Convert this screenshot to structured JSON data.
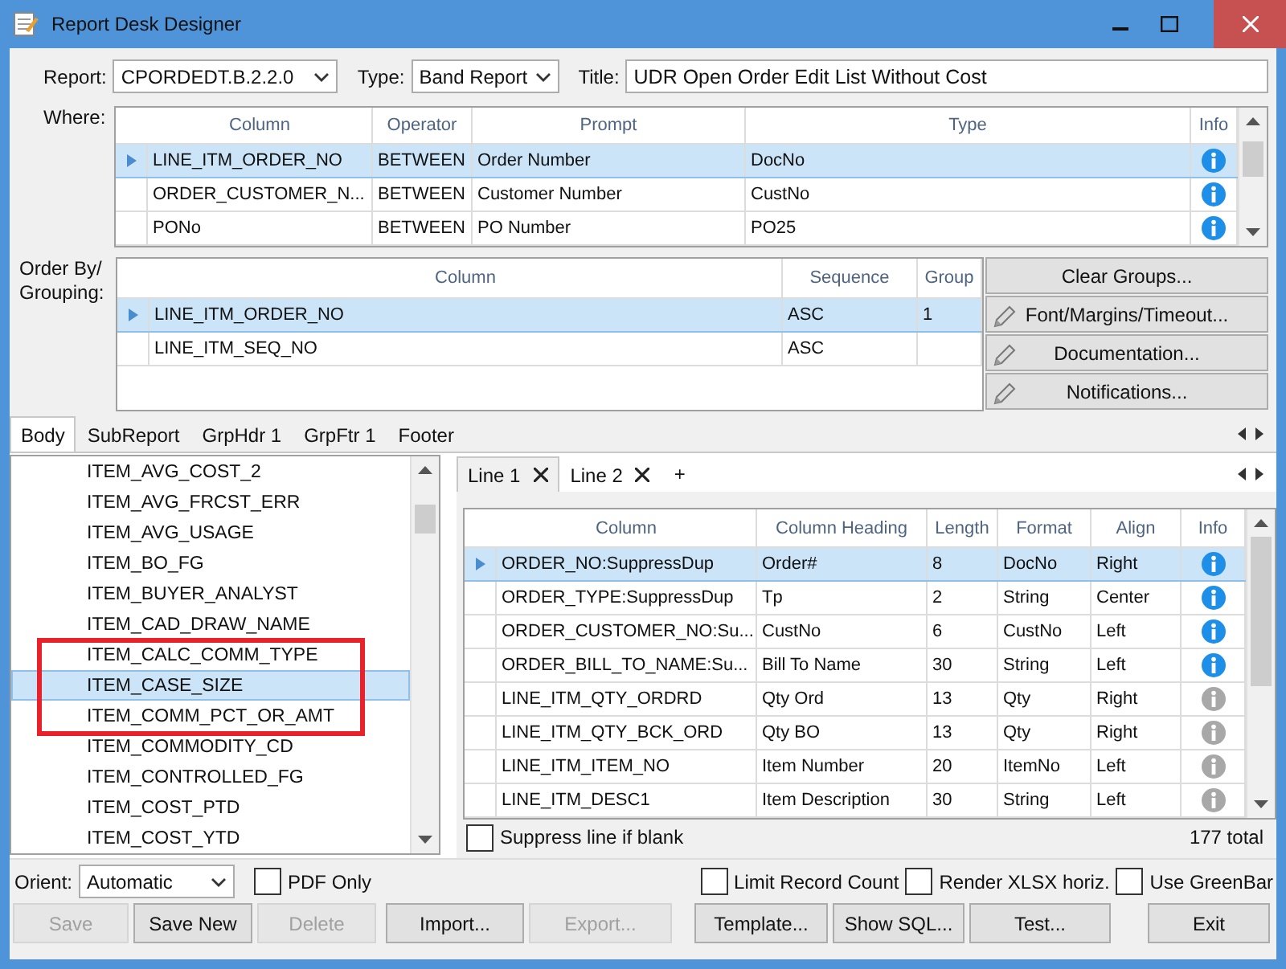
{
  "window": {
    "title": "Report Desk Designer"
  },
  "header": {
    "report": {
      "label": "Report:",
      "value": "CPORDEDT.B.2.2.0"
    },
    "type": {
      "label": "Type:",
      "value": "Band Report"
    },
    "title": {
      "label": "Title:",
      "value": "UDR Open Order Edit List Without Cost"
    }
  },
  "where": {
    "label": "Where:",
    "columns": [
      "Column",
      "Operator",
      "Prompt",
      "Type",
      "Info"
    ],
    "rows": [
      {
        "selected": true,
        "column": "LINE_ITM_ORDER_NO",
        "operator": "BETWEEN",
        "prompt": "Order Number",
        "type": "DocNo",
        "info_active": true
      },
      {
        "selected": false,
        "column": "ORDER_CUSTOMER_N...",
        "operator": "BETWEEN",
        "prompt": "Customer Number",
        "type": "CustNo",
        "info_active": true
      },
      {
        "selected": false,
        "column": "PONo",
        "operator": "BETWEEN",
        "prompt": "PO Number",
        "type": "PO25",
        "info_active": true
      }
    ]
  },
  "order_by": {
    "label": "Order By/ Grouping:",
    "columns": [
      "Column",
      "Sequence",
      "Group"
    ],
    "rows": [
      {
        "selected": true,
        "column": "LINE_ITM_ORDER_NO",
        "sequence": "ASC",
        "group": "1"
      },
      {
        "selected": false,
        "column": "LINE_ITM_SEQ_NO",
        "sequence": "ASC"
      }
    ],
    "buttons": [
      {
        "label": "Clear Groups...",
        "kind": "plain"
      },
      {
        "label": "Font/Margins/Timeout...",
        "kind": "pencil"
      },
      {
        "label": "Documentation...",
        "kind": "pencil"
      },
      {
        "label": "Notifications...",
        "kind": "pencil"
      }
    ]
  },
  "section_tabs": [
    {
      "label": "Body",
      "selected": true
    },
    {
      "label": "SubReport",
      "selected": false
    },
    {
      "label": "GrpHdr 1",
      "selected": false
    },
    {
      "label": "GrpFtr 1",
      "selected": false
    },
    {
      "label": "Footer",
      "selected": false
    }
  ],
  "field_list": [
    {
      "label": "ITEM_AVG_COST_2",
      "selected": false,
      "annotated": false
    },
    {
      "label": "ITEM_AVG_FRCST_ERR",
      "selected": false,
      "annotated": false
    },
    {
      "label": "ITEM_AVG_USAGE",
      "selected": false,
      "annotated": false
    },
    {
      "label": "ITEM_BO_FG",
      "selected": false,
      "annotated": false
    },
    {
      "label": "ITEM_BUYER_ANALYST",
      "selected": false,
      "annotated": false
    },
    {
      "label": "ITEM_CAD_DRAW_NAME",
      "selected": false,
      "annotated": false
    },
    {
      "label": "ITEM_CALC_COMM_TYPE",
      "selected": false,
      "annotated": true
    },
    {
      "label": "ITEM_CASE_SIZE",
      "selected": true,
      "annotated": true
    },
    {
      "label": "ITEM_COMM_PCT_OR_AMT",
      "selected": false,
      "annotated": true
    },
    {
      "label": "ITEM_COMMODITY_CD",
      "selected": false,
      "annotated": false
    },
    {
      "label": "ITEM_CONTROLLED_FG",
      "selected": false,
      "annotated": false
    },
    {
      "label": "ITEM_COST_PTD",
      "selected": false,
      "annotated": false
    },
    {
      "label": "ITEM_COST_YTD",
      "selected": false,
      "annotated": false
    }
  ],
  "line_tabs": {
    "tabs": [
      {
        "label": "Line 1",
        "selected": true
      },
      {
        "label": "Line 2",
        "selected": false
      }
    ],
    "add": "+"
  },
  "line_grid": {
    "columns": [
      "Column",
      "Column Heading",
      "Length",
      "Format",
      "Align",
      "Info"
    ],
    "rows": [
      {
        "selected": true,
        "column": "ORDER_NO:SuppressDup",
        "heading": "Order#",
        "length": "8",
        "format": "DocNo",
        "align": "Right",
        "info_active": true
      },
      {
        "selected": false,
        "column": "ORDER_TYPE:SuppressDup",
        "heading": "Tp",
        "length": "2",
        "format": "String",
        "align": "Center",
        "info_active": true
      },
      {
        "selected": false,
        "column": "ORDER_CUSTOMER_NO:Su...",
        "heading": "CustNo",
        "length": "6",
        "format": "CustNo",
        "align": "Left",
        "info_active": true
      },
      {
        "selected": false,
        "column": "ORDER_BILL_TO_NAME:Su...",
        "heading": "Bill To Name",
        "length": "30",
        "format": "String",
        "align": "Left",
        "info_active": true
      },
      {
        "selected": false,
        "column": "LINE_ITM_QTY_ORDRD",
        "heading": "Qty Ord",
        "length": "13",
        "format": "Qty",
        "align": "Right",
        "info_active": false
      },
      {
        "selected": false,
        "column": "LINE_ITM_QTY_BCK_ORD",
        "heading": "Qty BO",
        "length": "13",
        "format": "Qty",
        "align": "Right",
        "info_active": false
      },
      {
        "selected": false,
        "column": "LINE_ITM_ITEM_NO",
        "heading": "Item Number",
        "length": "20",
        "format": "ItemNo",
        "align": "Left",
        "info_active": false
      },
      {
        "selected": false,
        "column": "LINE_ITM_DESC1",
        "heading": "Item Description",
        "length": "30",
        "format": "String",
        "align": "Left",
        "info_active": false
      }
    ]
  },
  "suppress": {
    "label": "Suppress line if blank",
    "checked": false
  },
  "total": "177 total",
  "orient": {
    "label": "Orient:",
    "value": "Automatic"
  },
  "pdf_only": {
    "label": "PDF Only",
    "checked": false
  },
  "options": [
    {
      "label": "Limit Record Count",
      "checked": false
    },
    {
      "label": "Render XLSX horiz.",
      "checked": false
    },
    {
      "label": "Use GreenBar",
      "checked": false
    }
  ],
  "buttons": [
    {
      "label": "Save",
      "disabled": true
    },
    {
      "label": "Save New",
      "disabled": false
    },
    {
      "label": "Delete",
      "disabled": true
    },
    {
      "label": "Import...",
      "disabled": false
    },
    {
      "label": "Export...",
      "disabled": true
    },
    {
      "label": "Template...",
      "disabled": false
    },
    {
      "label": "Show SQL...",
      "disabled": false
    },
    {
      "label": "Test...",
      "disabled": false
    },
    {
      "label": "Exit",
      "disabled": false
    }
  ]
}
